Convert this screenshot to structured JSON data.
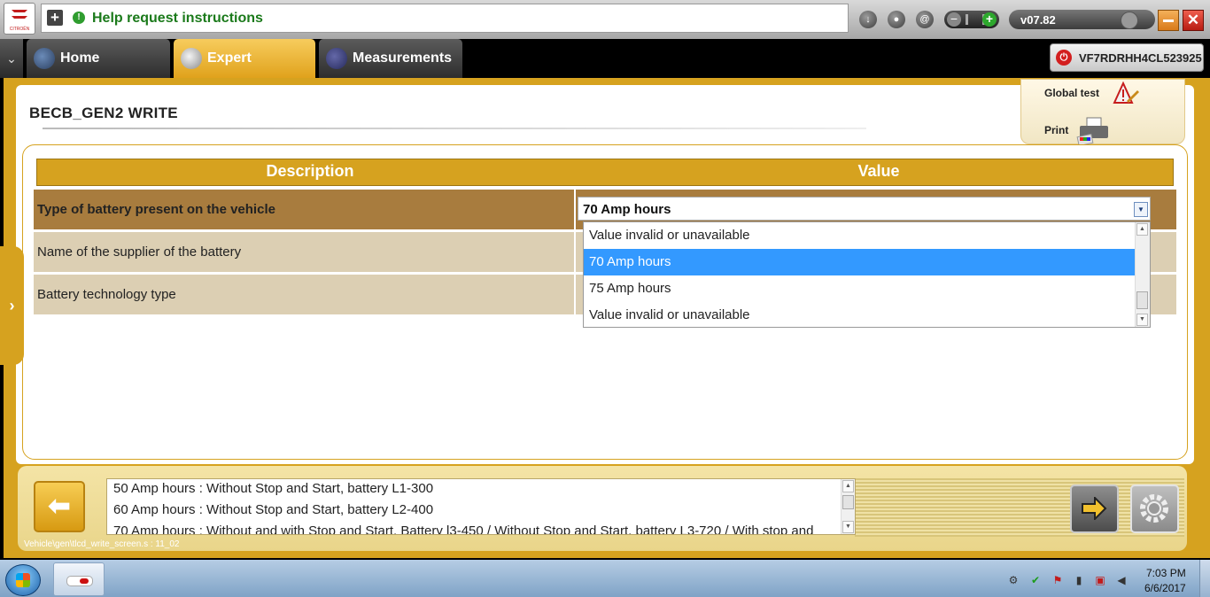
{
  "topbar": {
    "brand": "CITROËN",
    "help_text": "Help request instructions",
    "version": "v07.82"
  },
  "tabs": [
    {
      "label": "Home"
    },
    {
      "label": "Expert"
    },
    {
      "label": "Measurements"
    }
  ],
  "vin": "VF7RDRHH4CL523925",
  "page": {
    "title": "BECB_GEN2  WRITE",
    "global_test": "Global test",
    "print": "Print"
  },
  "table": {
    "headers": {
      "description": "Description",
      "value": "Value"
    },
    "rows": [
      {
        "description": "Type of battery present on the vehicle",
        "value": "70 Amp hours"
      },
      {
        "description": "Name of the supplier of the battery",
        "value": ""
      },
      {
        "description": "Battery technology type",
        "value": ""
      }
    ]
  },
  "dropdown": {
    "options": [
      "Value invalid or unavailable",
      "70 Amp hours",
      "75 Amp hours",
      "Value invalid or unavailable"
    ],
    "selected_index": 1
  },
  "info": {
    "lines": [
      "50 Amp hours : Without Stop and Start, battery L1-300",
      "60 Amp hours : Without Stop and Start, battery L2-400",
      "70 Amp hours : Without and with Stop and Start. Battery l3-450 / Without Stop and Start, battery L3-720 / With stop and"
    ]
  },
  "path": "Vehicle\\gen\\tlcd_write_screen.s : 11_02",
  "clock": {
    "time": "7:03 PM",
    "date": "6/6/2017"
  },
  "colors": {
    "accent": "#d6a21f",
    "selected_row": "#a87c3e",
    "row": "#dccfb3",
    "highlight": "#3399ff",
    "help_text": "#1b7a1b"
  }
}
